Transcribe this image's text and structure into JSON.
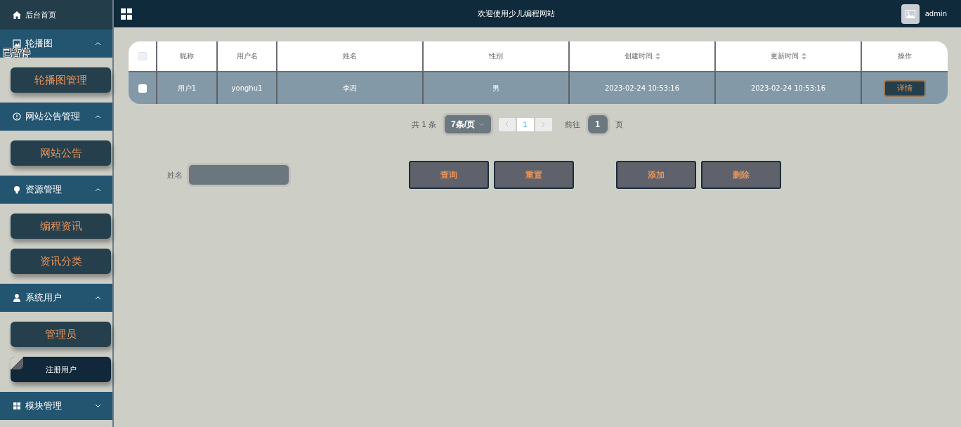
{
  "sidebar": {
    "home": "后台首页",
    "groups": [
      {
        "title": "轮播图",
        "kind": "image",
        "expanded": true,
        "items": [
          {
            "label": "轮播图管理",
            "selected": false
          }
        ]
      },
      {
        "title": "网站公告管理",
        "kind": "info",
        "expanded": true,
        "items": [
          {
            "label": "网站公告",
            "selected": false
          }
        ]
      },
      {
        "title": "资源管理",
        "kind": "bulb",
        "expanded": true,
        "items": [
          {
            "label": "编程资讯",
            "selected": false
          },
          {
            "label": "资讯分类",
            "selected": false
          }
        ]
      },
      {
        "title": "系统用户",
        "kind": "user",
        "expanded": true,
        "items": [
          {
            "label": "管理员",
            "selected": false
          },
          {
            "label": "注册用户",
            "selected": true
          }
        ]
      },
      {
        "title": "模块管理",
        "kind": "grid",
        "expanded": false
      }
    ]
  },
  "paused_overlay": "已暂停",
  "topbar": {
    "title": "欢迎使用少儿编程网站",
    "user": "admin"
  },
  "table": {
    "header_checked": false,
    "columns": [
      {
        "label": "昵称",
        "sortable": false
      },
      {
        "label": "用户名",
        "sortable": false
      },
      {
        "label": "姓名",
        "sortable": false
      },
      {
        "label": "性别",
        "sortable": false
      },
      {
        "label": "创建时间",
        "sortable": true
      },
      {
        "label": "更新时间",
        "sortable": true
      },
      {
        "label": "操作",
        "sortable": false
      }
    ],
    "rows": [
      {
        "checked": false,
        "cells": [
          "用户1",
          "yonghu1",
          "李四",
          "男",
          "2023-02-24 10:53:16",
          "2023-02-24 10:53:16"
        ],
        "action": "详情"
      }
    ]
  },
  "pagination": {
    "total": "共 1 条",
    "page_size": "7条/页",
    "pages": [
      {
        "label": "1",
        "selected": true
      }
    ],
    "goto_label": "前往",
    "goto_value": "1",
    "page_suffix": "页"
  },
  "search": {
    "label": "姓名"
  },
  "search_buttons": [
    "查询",
    "重置"
  ],
  "action_buttons": [
    "添加",
    "删除"
  ]
}
